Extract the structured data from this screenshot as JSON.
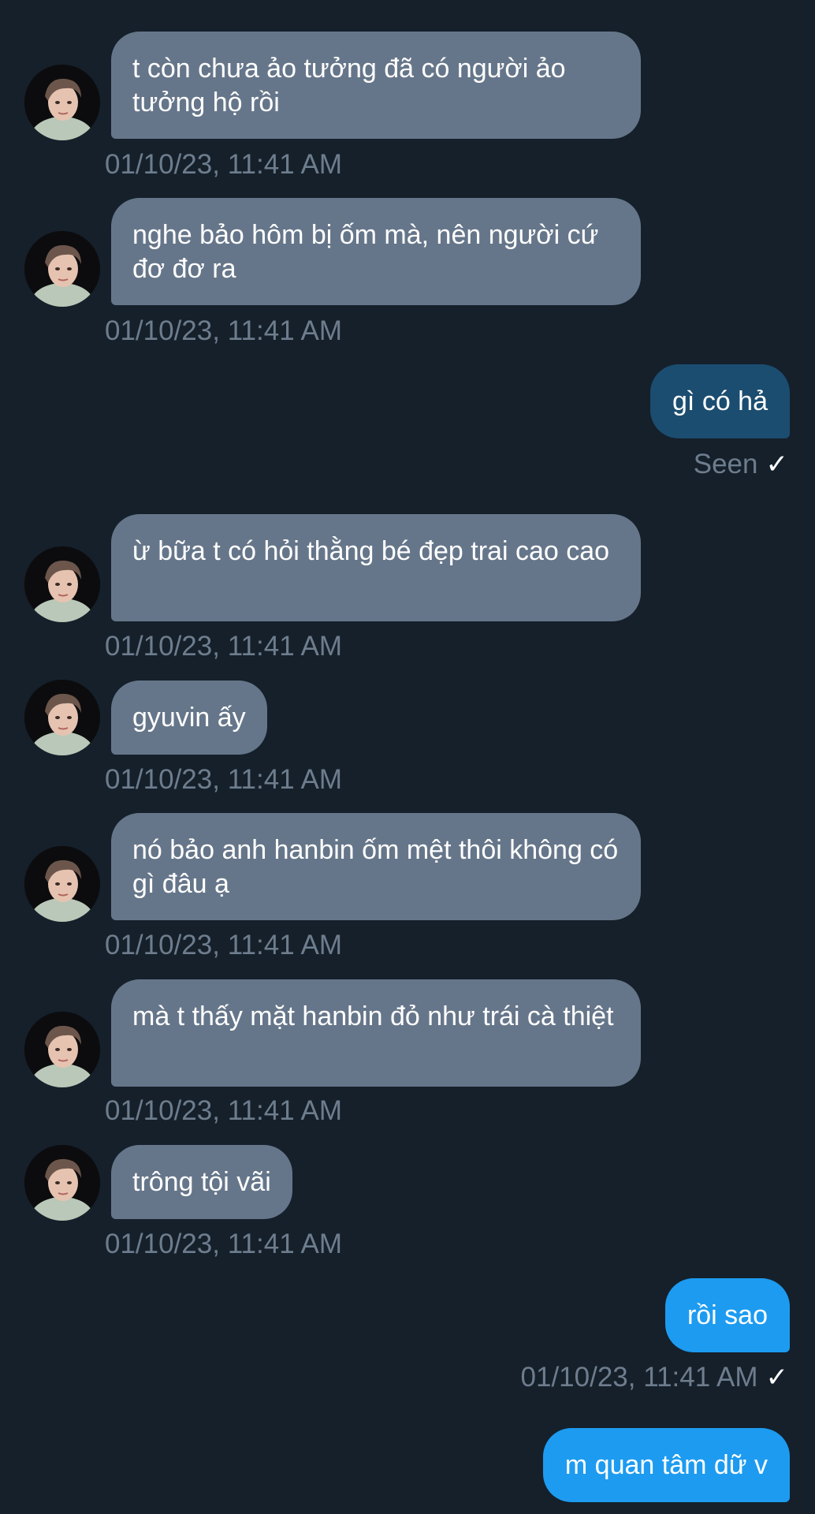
{
  "colors": {
    "background": "#15202b",
    "incoming_bubble": "#66768a",
    "outgoing_seen_bubble": "#1b4d70",
    "outgoing_bubble": "#1d9bf0",
    "meta_text": "#6e7d8d"
  },
  "messages": [
    {
      "direction": "in",
      "text": "t còn chưa ảo tưởng đã có người ảo tưởng hộ rồi",
      "timestamp": "01/10/23, 11:41 AM"
    },
    {
      "direction": "in",
      "text": "nghe bảo hôm bị ốm mà, nên người cứ đơ đơ ra",
      "timestamp": "01/10/23, 11:41 AM"
    },
    {
      "direction": "out",
      "text": "gì có hả",
      "status": "Seen"
    },
    {
      "direction": "in",
      "text": "ừ bữa t có hỏi thằng bé đẹp trai cao cao",
      "timestamp": "01/10/23, 11:41 AM"
    },
    {
      "direction": "in",
      "text": "gyuvin ấy",
      "timestamp": "01/10/23, 11:41 AM"
    },
    {
      "direction": "in",
      "text": "nó bảo anh hanbin ốm mệt thôi không có gì đâu ạ",
      "timestamp": "01/10/23, 11:41 AM"
    },
    {
      "direction": "in",
      "text": "mà t thấy mặt hanbin đỏ như trái cà thiệt",
      "timestamp": "01/10/23, 11:41 AM"
    },
    {
      "direction": "in",
      "text": "trông tội vãi",
      "timestamp": "01/10/23, 11:41 AM"
    },
    {
      "direction": "out",
      "text": "rồi sao",
      "timestamp": "01/10/23, 11:41 AM"
    },
    {
      "direction": "out",
      "text": "m quan tâm dữ v"
    }
  ],
  "icons": {
    "check": "✓",
    "avatar": "profile-avatar-icon"
  }
}
